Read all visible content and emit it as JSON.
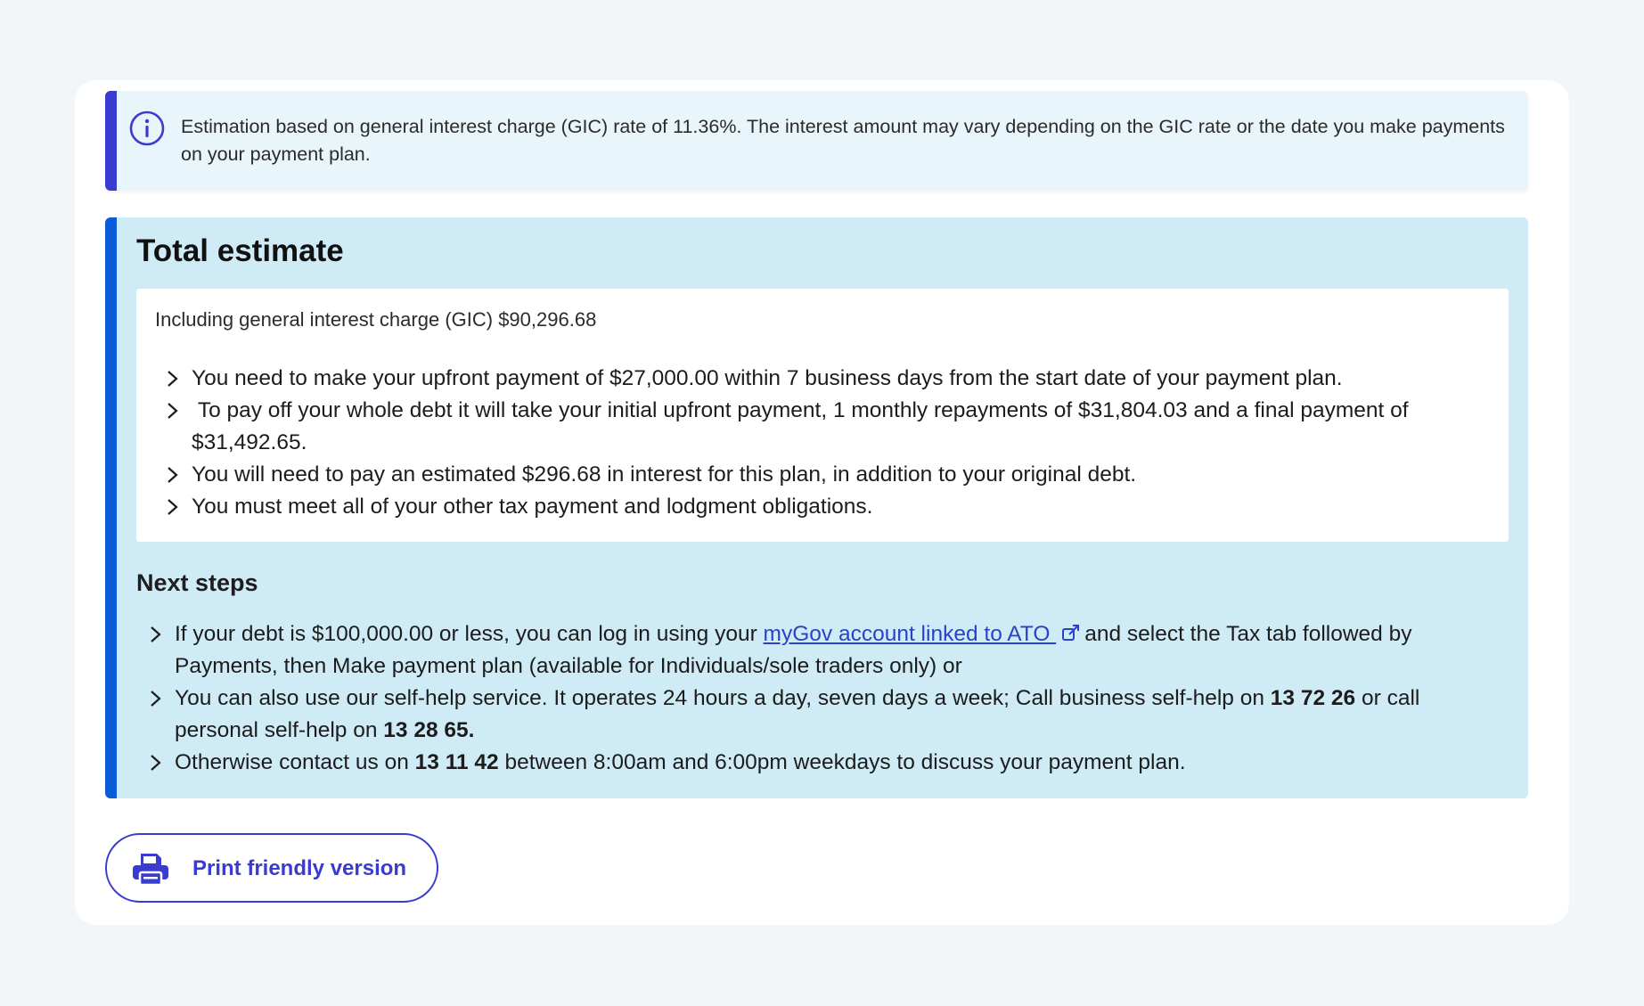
{
  "info": {
    "text": "Estimation based on general interest charge (GIC) rate of 11.36%. The interest amount may vary depending on the GIC rate or the date you make payments on your payment plan."
  },
  "estimate": {
    "title": "Total estimate",
    "gic_line": "Including general interest charge (GIC) $90,296.68",
    "items": [
      "You need to make your upfront payment of $27,000.00 within 7 business days from the start date of your payment plan.",
      " To pay off your whole debt it will take your initial upfront payment, 1 monthly repayments of $31,804.03 and a final payment of $31,492.65.",
      "You will need to pay an estimated $296.68 in interest for this plan, in addition to your original debt.",
      "You must meet all of your other tax payment and lodgment obligations."
    ]
  },
  "next_steps": {
    "title": "Next steps",
    "step1": {
      "before": "If your debt is $100,000.00 or less, you can log in using your ",
      "link": "myGov account linked to ATO ",
      "after": "and select the Tax tab followed by Payments, then Make payment plan (available for Individuals/sole traders only) or"
    },
    "step2": {
      "before": "You can also use our self-help service. It operates 24 hours a day, seven days a week; Call business self-help on ",
      "number1": "13 72 26",
      "middle": " or call personal self-help on ",
      "number2": "13 28 65."
    },
    "step3": {
      "before": "Otherwise contact us on ",
      "number": "13 11 42",
      "after": " between 8:00am and 6:00pm weekdays to discuss your payment plan."
    }
  },
  "print_button": {
    "label": "Print friendly version"
  },
  "colors": {
    "accent": "#3a3ccf",
    "estimate_border": "#0b5ad8",
    "estimate_bg": "#cfebf6",
    "info_bg": "#e8f5fb",
    "link": "#2a42c9"
  },
  "icons": {
    "info": "info-circle-icon",
    "chevron": "chevron-right-icon",
    "external_link": "external-link-icon",
    "print": "printer-icon"
  }
}
